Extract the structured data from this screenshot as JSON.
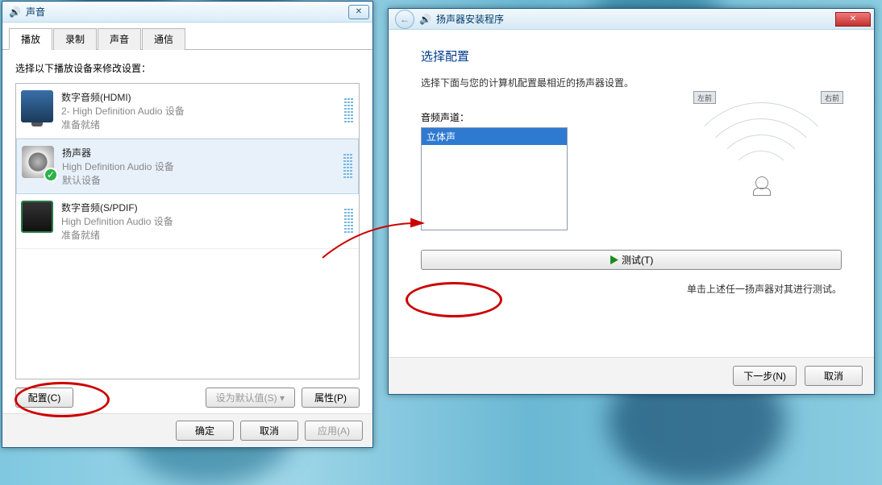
{
  "sound_dialog": {
    "title": "声音",
    "tabs": [
      "播放",
      "录制",
      "声音",
      "通信"
    ],
    "active_tab": 0,
    "instruction": "选择以下播放设备来修改设置：",
    "devices": [
      {
        "title": "数字音频(HDMI)",
        "sub": "2- High Definition Audio 设备",
        "status": "准备就绪",
        "default": false
      },
      {
        "title": "扬声器",
        "sub": "High Definition Audio 设备",
        "status": "默认设备",
        "default": true
      },
      {
        "title": "数字音频(S/PDIF)",
        "sub": "High Definition Audio 设备",
        "status": "准备就绪",
        "default": false
      }
    ],
    "configure_btn": "配置(C)",
    "set_default_btn": "设为默认值(S)",
    "properties_btn": "属性(P)",
    "ok_btn": "确定",
    "cancel_btn": "取消",
    "apply_btn": "应用(A)"
  },
  "wizard": {
    "title": "扬声器安装程序",
    "heading": "选择配置",
    "subtitle": "选择下面与您的计算机配置最相近的扬声器设置。",
    "audio_label": "音频声道：",
    "channels_options": [
      "立体声"
    ],
    "selected_channel": 0,
    "test_btn": "测试(T)",
    "speaker_left": "左前",
    "speaker_right": "右前",
    "hint": "单击上述任一扬声器对其进行测试。",
    "next_btn": "下一步(N)",
    "cancel_btn": "取消"
  }
}
